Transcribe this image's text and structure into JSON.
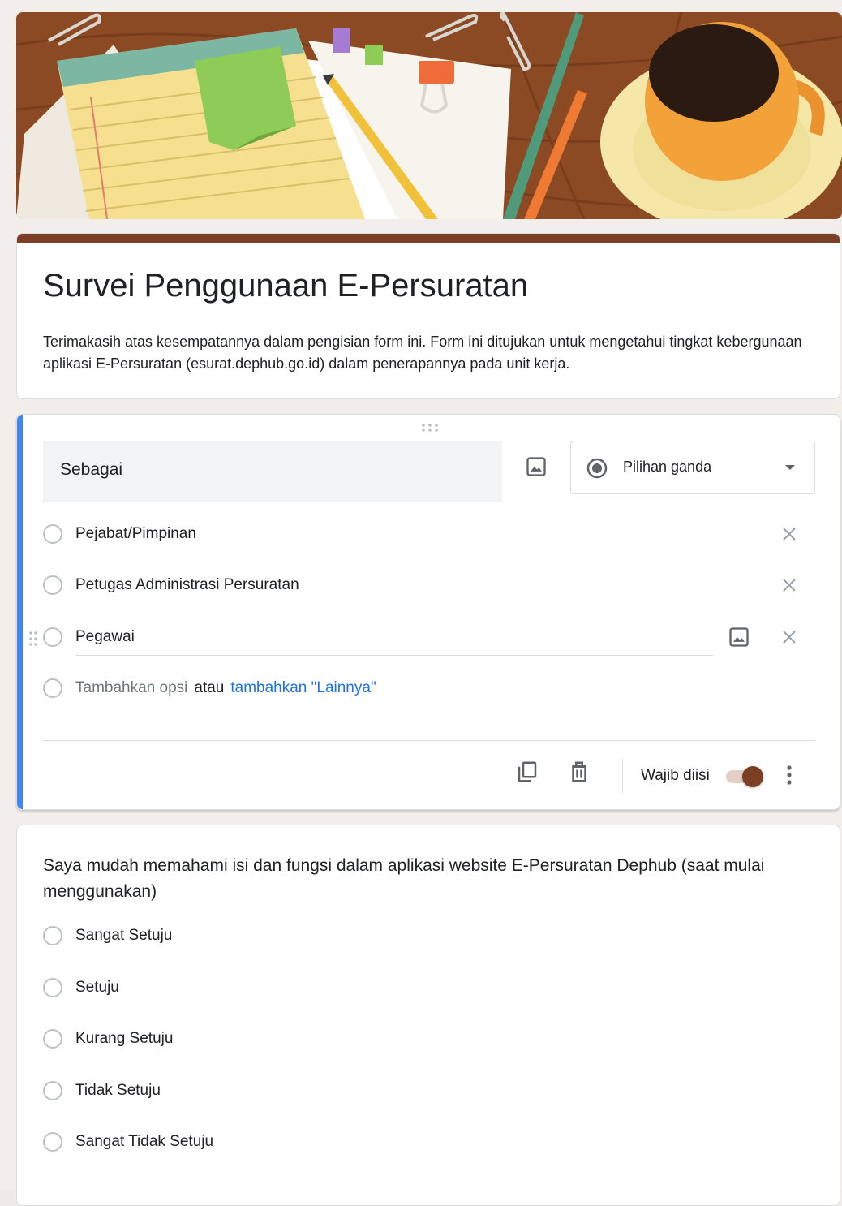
{
  "form": {
    "title": "Survei Penggunaan E-Persuratan",
    "description": "Terimakasih atas kesempatannya dalam pengisian form ini. Form ini ditujukan untuk mengetahui tingkat kebergunaan aplikasi E-Persuratan (esurat.dephub.go.id) dalam penerapannya pada unit kerja.",
    "theme_color": "#7b3f26",
    "active_accent": "#4285f4"
  },
  "question1": {
    "title": "Sebagai",
    "type_label": "Pilihan ganda",
    "options": [
      {
        "label": "Pejabat/Pimpinan"
      },
      {
        "label": "Petugas Administrasi Persuratan"
      },
      {
        "label": "Pegawai"
      }
    ],
    "add_option_label": "Tambahkan opsi",
    "or_label": "atau",
    "add_other_label": "tambahkan \"Lainnya\"",
    "required_label": "Wajib diisi",
    "required": true
  },
  "question2": {
    "title": "Saya mudah memahami isi dan fungsi dalam aplikasi website E-Persuratan Dephub (saat mulai menggunakan)",
    "options": [
      {
        "label": "Sangat Setuju"
      },
      {
        "label": "Setuju"
      },
      {
        "label": "Kurang Setuju"
      },
      {
        "label": "Tidak Setuju"
      },
      {
        "label": "Sangat Tidak Setuju"
      }
    ]
  },
  "icons": {
    "add_image": "image-icon",
    "remove_option": "close-icon",
    "duplicate": "copy-icon",
    "delete": "trash-icon",
    "more": "more-vert-icon",
    "drag": "drag-handle-icon",
    "type_radio": "radio-button-checked-icon",
    "dropdown": "arrow-drop-down-icon"
  }
}
